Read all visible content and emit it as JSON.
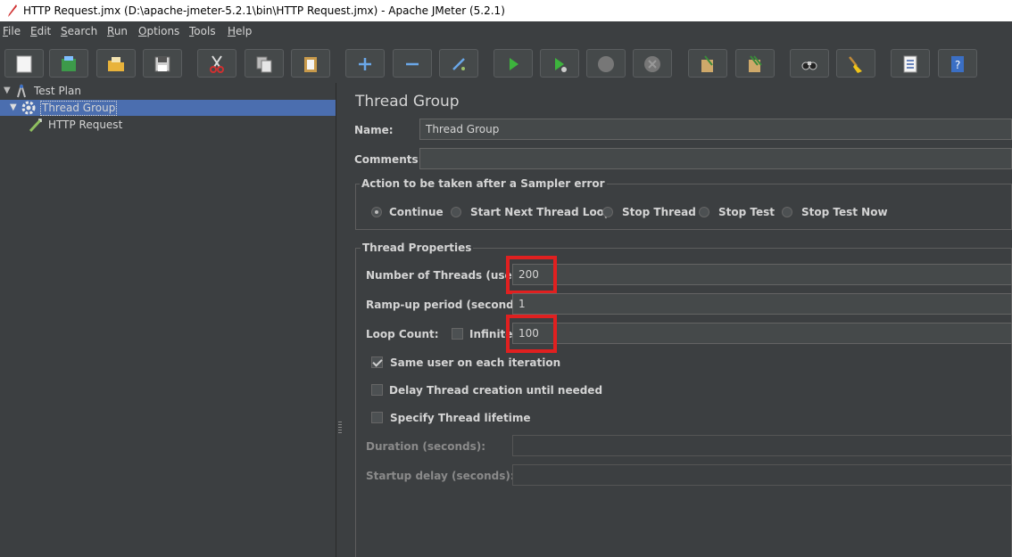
{
  "window": {
    "title": "HTTP Request.jmx (D:\\apache-jmeter-5.2.1\\bin\\HTTP Request.jmx) - Apache JMeter (5.2.1)"
  },
  "menu": [
    {
      "label": "File",
      "u": "F",
      "rest": "ile"
    },
    {
      "label": "Edit",
      "u": "E",
      "rest": "dit"
    },
    {
      "label": "Search",
      "u": "S",
      "rest": "earch"
    },
    {
      "label": "Run",
      "u": "R",
      "rest": "un"
    },
    {
      "label": "Options",
      "u": "O",
      "rest": "ptions"
    },
    {
      "label": "Tools",
      "u": "T",
      "rest": "ools"
    },
    {
      "label": "Help",
      "u": "H",
      "rest": "elp"
    }
  ],
  "toolbar": {
    "icons": [
      "new-icon",
      "templates-icon",
      "open-icon",
      "save-icon",
      "cut-icon",
      "copy-icon",
      "paste-icon",
      "expand-icon",
      "collapse-icon",
      "toggle-icon",
      "start-icon",
      "start-no-pauses-icon",
      "stop-icon",
      "shutdown-icon",
      "clear-icon",
      "clear-all-icon",
      "search-icon",
      "reset-search-icon",
      "function-helper-icon",
      "help-icon"
    ]
  },
  "tree": {
    "items": [
      {
        "label": "Test Plan",
        "icon": "test-plan-icon"
      },
      {
        "label": "Thread Group",
        "icon": "thread-group-gear-icon",
        "selected": true
      },
      {
        "label": "HTTP Request",
        "icon": "http-request-sampler-icon"
      }
    ]
  },
  "panel": {
    "heading": "Thread Group",
    "name_label": "Name:",
    "name_value": "Thread Group",
    "comments_label": "Comments:",
    "comments_value": "",
    "error_action": {
      "title": "Action to be taken after a Sampler error",
      "options": [
        "Continue",
        "Start Next Thread Loop",
        "Stop Thread",
        "Stop Test",
        "Stop Test Now"
      ],
      "selected": "Continue"
    },
    "thread_props": {
      "title": "Thread Properties",
      "threads_label": "Number of Threads (users):",
      "threads_value": "200",
      "rampup_label": "Ramp-up period (seconds):",
      "rampup_value": "1",
      "loop_label": "Loop Count:",
      "infinite_label": "Infinite",
      "infinite_checked": false,
      "loop_value": "100",
      "same_user_label": "Same user on each iteration",
      "same_user_checked": true,
      "delay_label": "Delay Thread creation until needed",
      "delay_checked": false,
      "lifetime_label": "Specify Thread lifetime",
      "lifetime_checked": false,
      "duration_label": "Duration (seconds):",
      "duration_value": "",
      "startup_label": "Startup delay (seconds):",
      "startup_value": ""
    }
  },
  "colors": {
    "background": "#3c3f41",
    "selection": "#4b6eaf",
    "highlight_box": "#e02020"
  }
}
